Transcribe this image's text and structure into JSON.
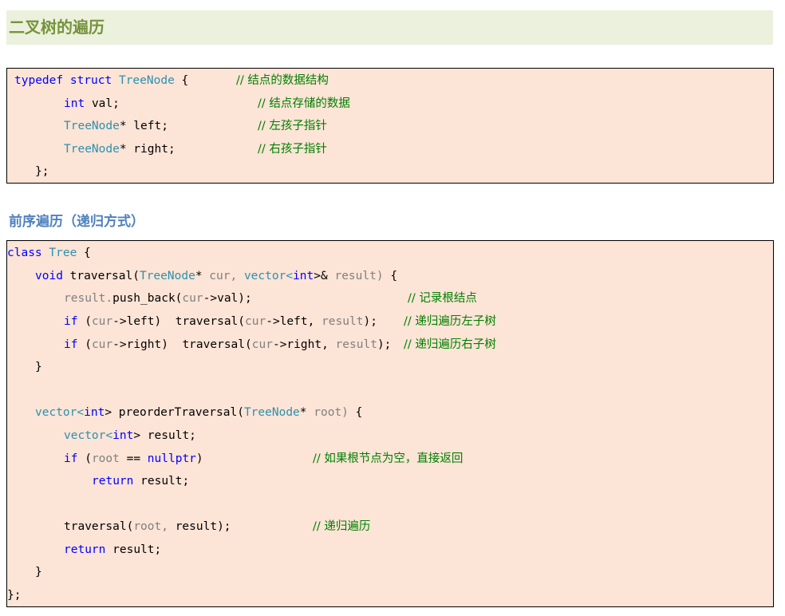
{
  "heading_main": "二叉树的遍历",
  "heading_preorder": "前序遍历（递归方式）",
  "struct_code": {
    "l1": {
      "kw_typedef": "typedef",
      "kw_struct": "struct",
      "type": "TreeNode",
      "brace": "{",
      "comment": "// 结点的数据结构"
    },
    "l2": {
      "kw_int": "int",
      "rest": "val;",
      "comment": "// 结点存储的数据"
    },
    "l3": {
      "type": "TreeNode",
      "rest": "* left;",
      "comment": "// 左孩子指针"
    },
    "l4": {
      "type": "TreeNode",
      "rest": "* right;",
      "comment": "// 右孩子指针"
    },
    "l5": {
      "text": "};"
    }
  },
  "class_code": {
    "l1": {
      "kw_class": "class",
      "type": "Tree",
      "brace": "{"
    },
    "l2": {
      "kw_void": "void",
      "name": "traversal(",
      "type1": "TreeNode",
      "p1": "*",
      "arg1": "cur,",
      "type2": "vector",
      "lt": "<",
      "kw_int": "int",
      "gt": ">&",
      "arg2": "result)",
      "brace": "{"
    },
    "l3": {
      "arg": "result.",
      "call": "push_back(",
      "arg2": "cur",
      "rest": "->val);",
      "comment": "// 记录根结点"
    },
    "l4": {
      "kw_if": "if",
      "open": "(",
      "arg": "cur",
      "cond": "->left)",
      "call": "traversal(",
      "arg2": "cur",
      "mid": "->left,",
      "arg3": "result",
      "end": ");",
      "comment": "// 递归遍历左子树"
    },
    "l5": {
      "kw_if": "if",
      "open": "(",
      "arg": "cur",
      "cond": "->right)",
      "call": "traversal(",
      "arg2": "cur",
      "mid": "->right,",
      "arg3": "result",
      "end": ");",
      "comment": "// 递归遍历右子树"
    },
    "l6": {
      "text": "}"
    },
    "l7": {
      "type": "vector",
      "lt": "<",
      "kw_int": "int",
      "gt": ">",
      "name": "preorderTraversal(",
      "type2": "TreeNode",
      "p": "*",
      "arg": "root)",
      "brace": "{"
    },
    "l8": {
      "type": "vector",
      "lt": "<",
      "kw_int": "int",
      "gt": ">",
      "rest": "result;"
    },
    "l9": {
      "kw_if": "if",
      "open": "(",
      "arg": "root",
      "eq": "==",
      "kw_null": "nullptr",
      "close": ")",
      "comment": "// 如果根节点为空，直接返回"
    },
    "l10": {
      "kw_return": "return",
      "rest": "result;"
    },
    "l11": {
      "call": "traversal(",
      "arg": "root,",
      "rest": "result);",
      "comment": "// 递归遍历"
    },
    "l12": {
      "kw_return": "return",
      "rest": "result;"
    },
    "l13": {
      "text": "}"
    },
    "l14": {
      "text": "};"
    }
  }
}
